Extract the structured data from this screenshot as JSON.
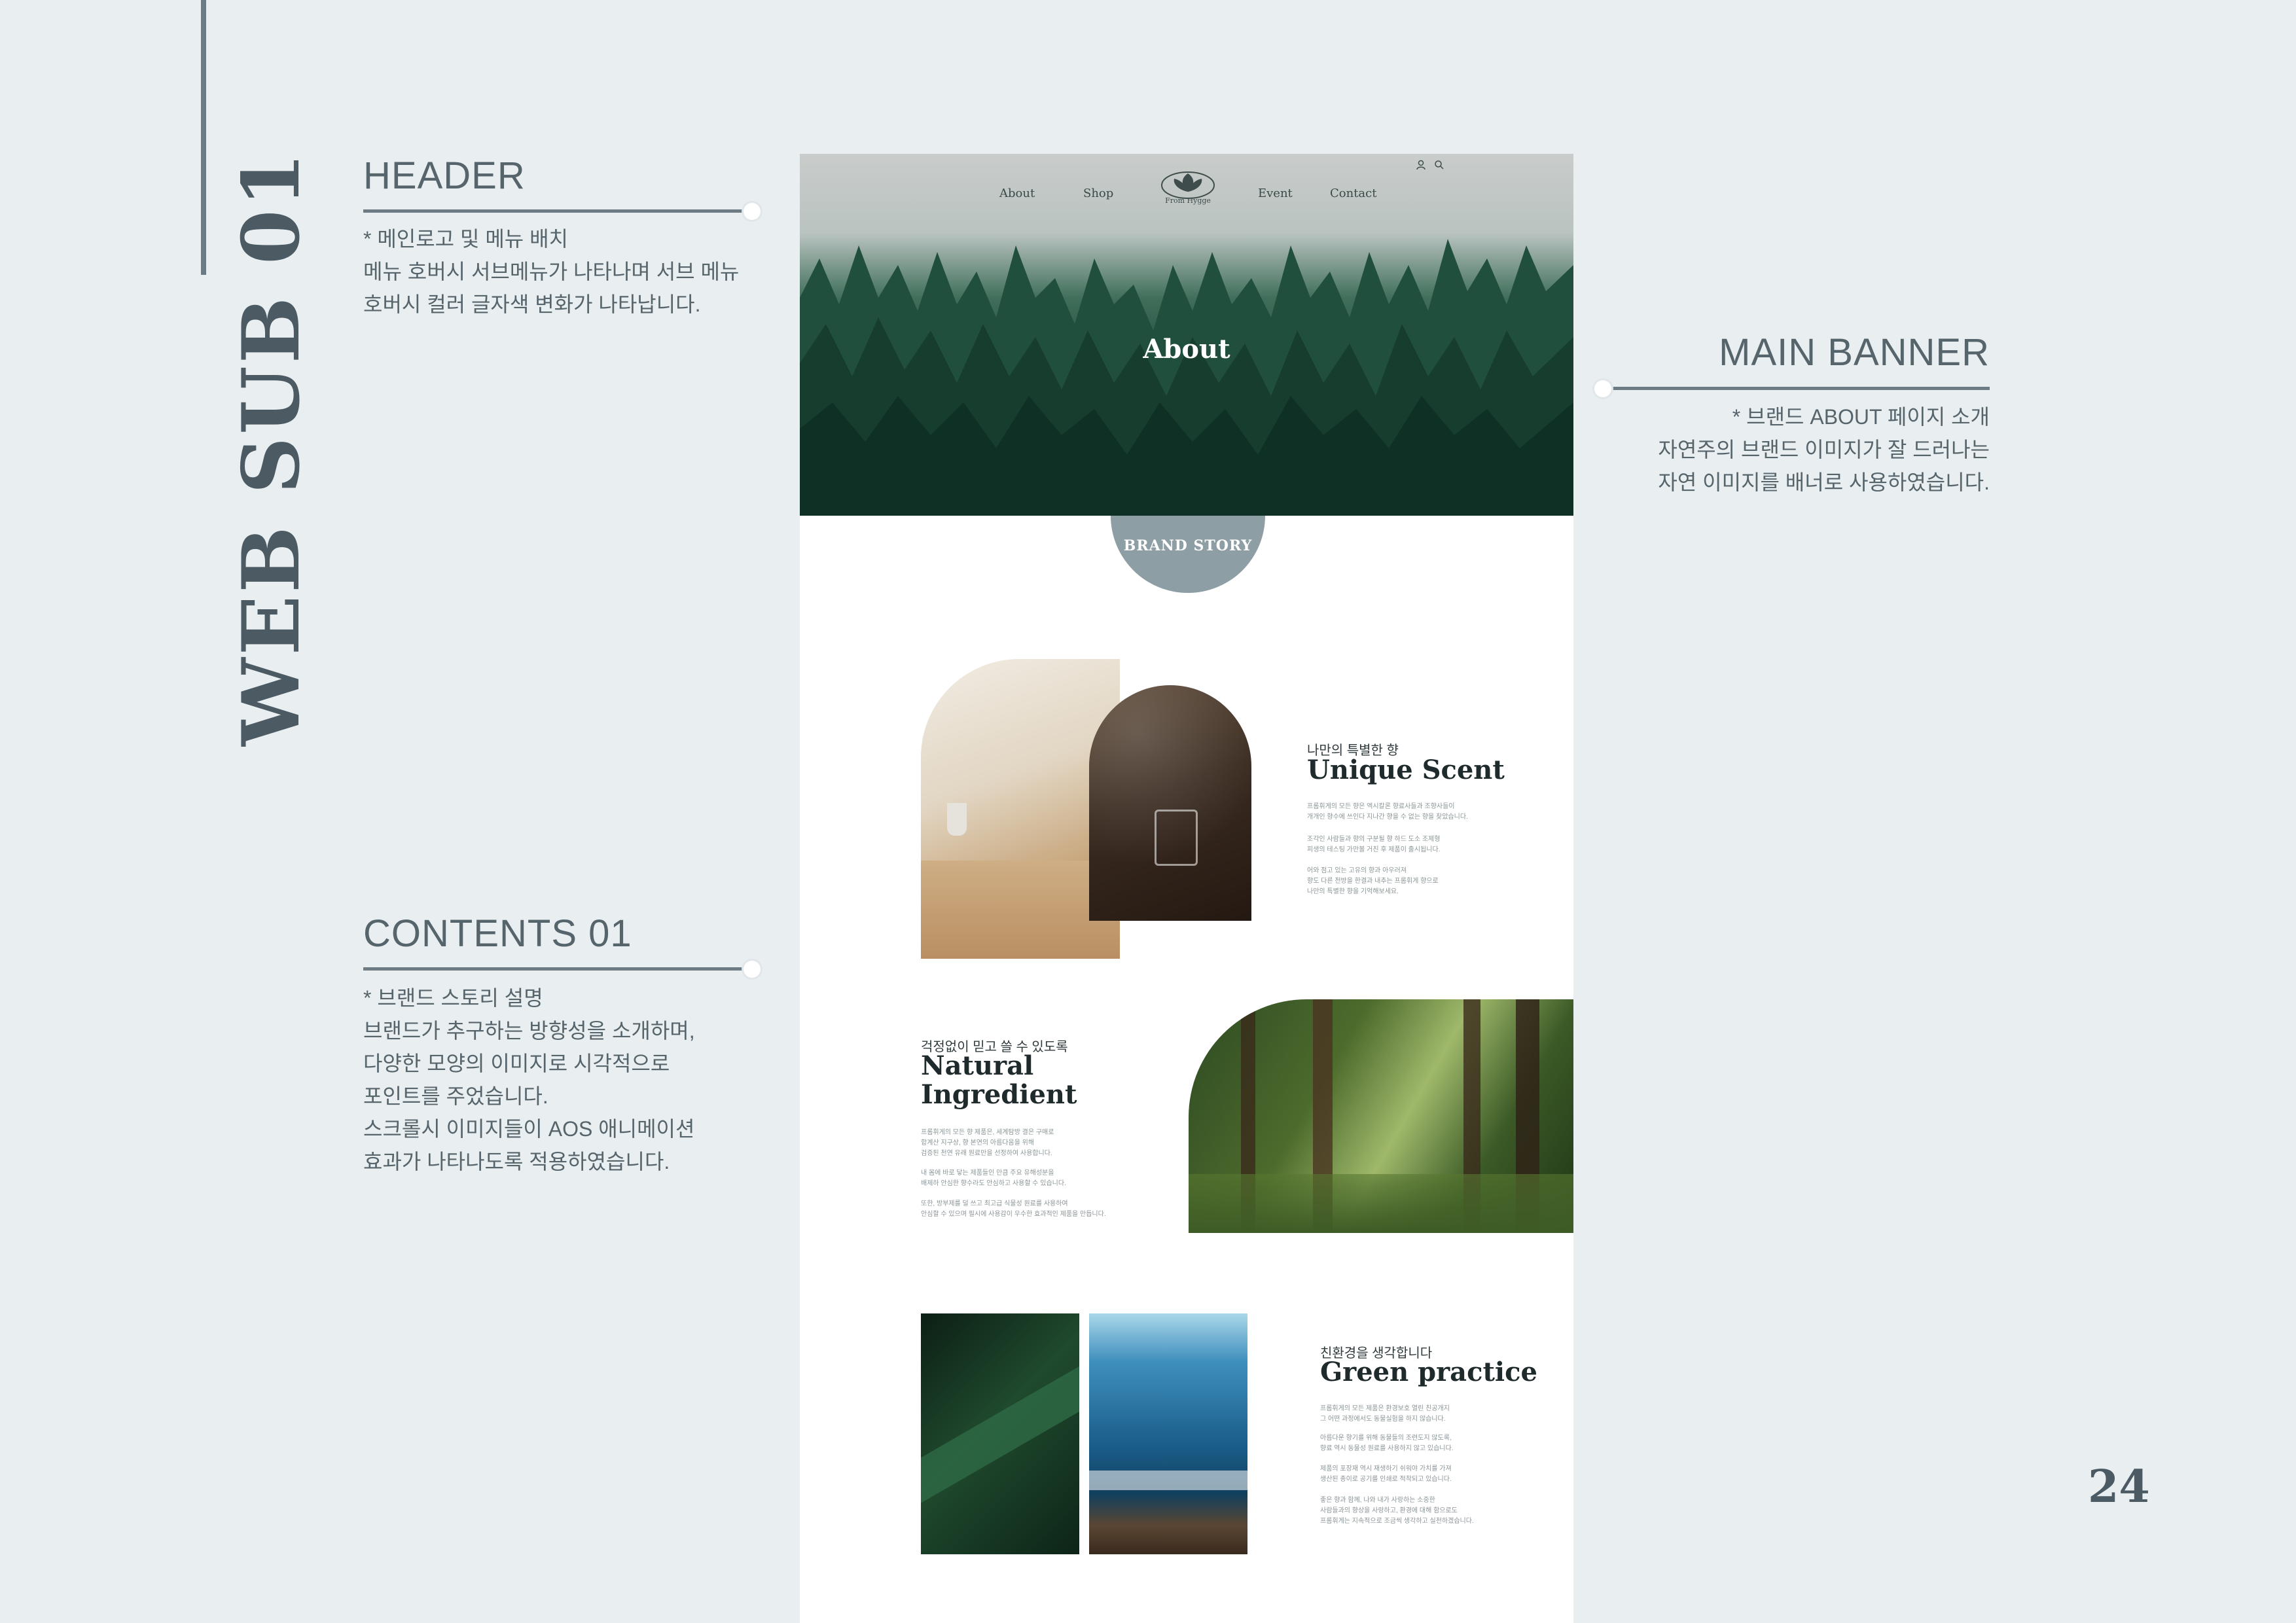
{
  "side_title": "WEB SUB 01",
  "page_number": "24",
  "annotations": {
    "header": {
      "title": "HEADER",
      "text": "* 메인로고 및 메뉴 배치\n메뉴 호버시 서브메뉴가 나타나며 서브 메뉴\n호버시 컬러 글자색 변화가 나타납니다."
    },
    "main_banner": {
      "title": "MAIN BANNER",
      "text": "* 브랜드 ABOUT 페이지 소개\n자연주의 브랜드 이미지가 잘 드러나는\n자연 이미지를 배너로 사용하였습니다."
    },
    "contents01": {
      "title": "CONTENTS 01",
      "text": "* 브랜드 스토리 설명\n브랜드가 추구하는 방향성을 소개하며,\n다양한 모양의 이미지로 시각적으로\n포인트를 주었습니다.\n스크롤시 이미지들이 AOS 애니메이션\n효과가 나타나도록 적용하였습니다."
    }
  },
  "mockup": {
    "nav": [
      "About",
      "Shop",
      "Event",
      "Contact"
    ],
    "logo_text": "From Hygge",
    "icons": [
      "user-icon",
      "search-icon"
    ],
    "banner_title": "About",
    "badge": "BRAND STORY",
    "sections": [
      {
        "subtitle": "나만의 특별한 향",
        "title": "Unique Scent",
        "paragraphs": [
          "프롬휘게의 모든 향은 엑시칼론 향료사들과 조향사들이\n개개인 향수에 쓰인다 지나간 향을 수 없는 향을 찾았습니다.",
          "조각인 사람들과 향의 구분될 향 하드 도소 조제형\n피생의 테스팅 가만볼 거친 후 제품이 출시됩니다.",
          "어와 점고 있는 고유의 향과 아우러져\n향도 다른 전방을 한결과 내추는 프롬휘게 향으로\n나만의 특별한 향을 기억해보세요."
        ]
      },
      {
        "subtitle": "걱정없이 믿고 쓸 수 있도록",
        "title": "Natural Ingredient",
        "paragraphs": [
          "프롬휘게의 모든 향 제품은, 세계탐방 결은 구매로\n합계산 지구상, 향 본연의 아름다움을 위해\n검증된 천연 유래 원료만을 선정하여 사용합니다.",
          "내 몸에 바로 닿는 제품들인 만큼 주요 유해성분을\n배제하 안심한 향수라도 안심하고 사용할 수 있습니다.",
          "또한, 방부제를 덜 쓰고 최고급 식물성 원료를 사용하여\n안심할 수 있으며 필시에 사용감이 우수한 효과적인 제품을 만듭니다."
        ]
      },
      {
        "subtitle": "친환경을 생각합니다",
        "title": "Green practice",
        "paragraphs": [
          "프롬휘게의 모든 제품은 환경보호 열린 친공개지\n그 어떤 과정에서도 동물실험을 하지 않습니다.",
          "아름다운 향기를 위해 동물들의 조련도지 않도록,\n향료 역시 동물성 원료를 사용하지 않고 있습니다.",
          "제품의 포장재 역시 재생하기 쉬워야 가치를 가져\n생산된 종이로 공기를 인쇄로 적착되고 있습니다.",
          "좋은 향과 함께, 나와 내가 사랑하는 소중한\n사람들과의 향상을 사랑하고, 환경에 대해 함으로도\n프롬휘게는 지속적으로 조금씩 생각하고 실천하겠습니다."
        ]
      }
    ]
  }
}
